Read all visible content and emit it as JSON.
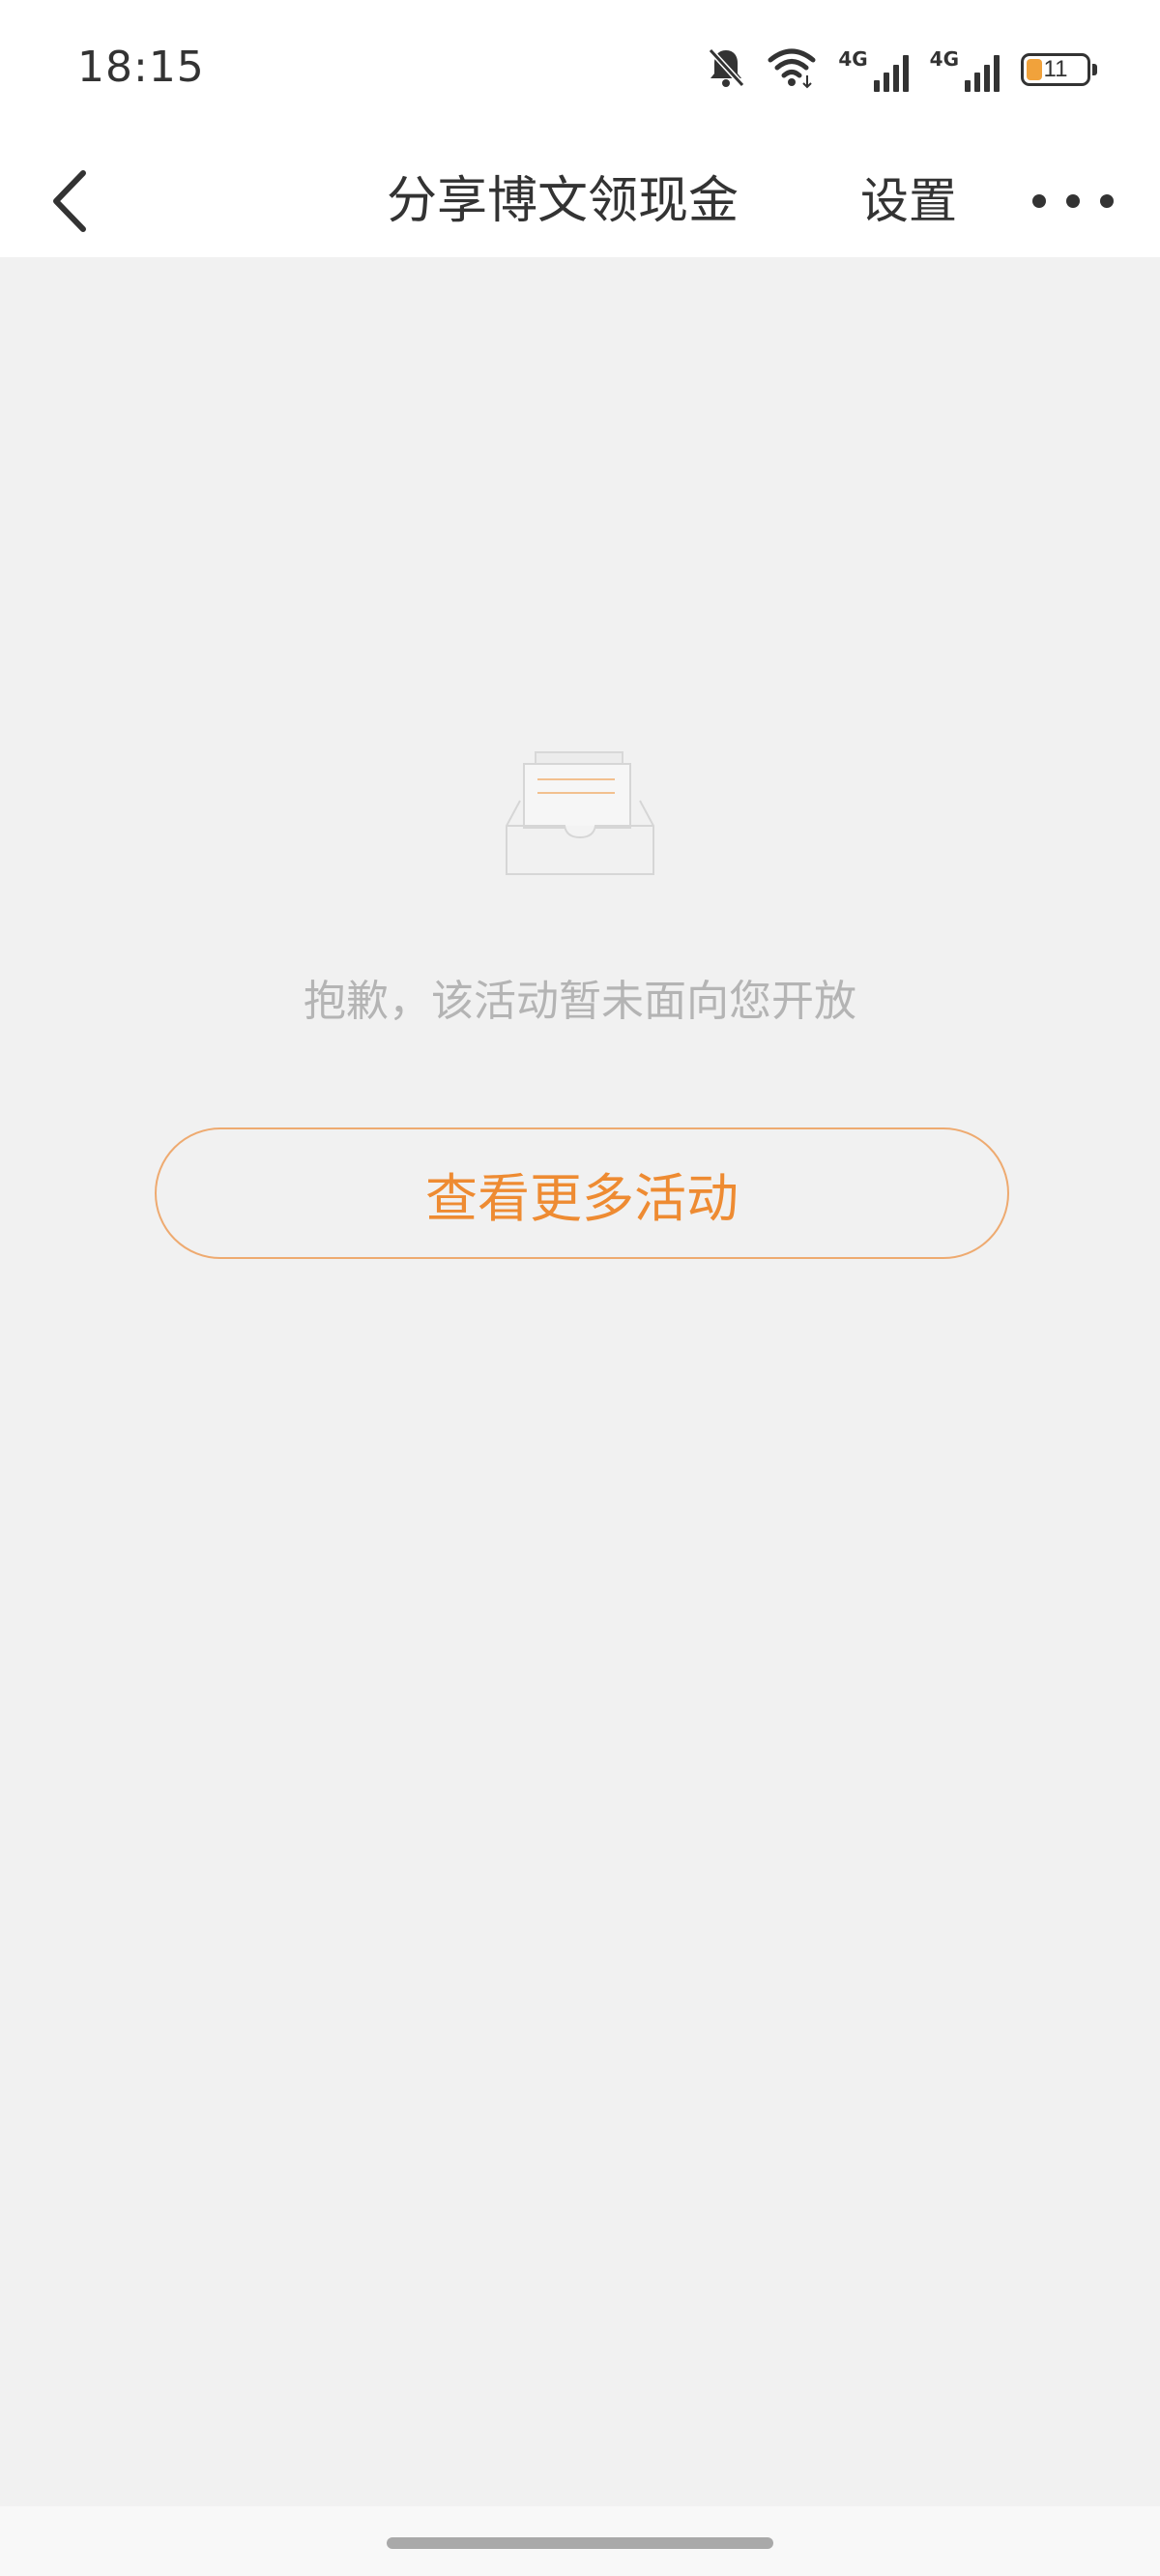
{
  "status_bar": {
    "time": "18:15",
    "network_1": "4G",
    "network_2": "4G",
    "battery_level": "11",
    "battery_fraction": 0.11,
    "icons": [
      "bell-off-icon",
      "wifi-icon",
      "signal-icon",
      "signal-icon",
      "battery-icon"
    ]
  },
  "nav": {
    "back_icon": "chevron-left-icon",
    "title": "分享博文领现金",
    "settings_label": "设置",
    "more_icon": "more-horizontal-icon"
  },
  "empty_state": {
    "illustration_icon": "empty-inbox-icon",
    "message": "抱歉，该活动暂未面向您开放",
    "button_label": "查看更多活动"
  },
  "colors": {
    "background": "#f1f1f1",
    "accent": "#ee8b32",
    "accent_border": "#eeaa70",
    "muted_text": "#b4b4b4",
    "battery": "#f1a23b"
  }
}
